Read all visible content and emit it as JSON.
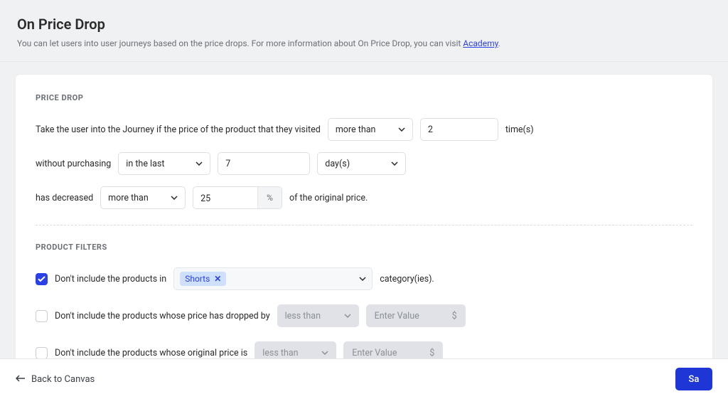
{
  "header": {
    "title": "On Price Drop",
    "desc_before": "You can let users into user journeys based on the price drops. For more information about On Price Drop, you can visit ",
    "desc_link": "Academy",
    "desc_after": "."
  },
  "price_drop": {
    "section_label": "PRICE DROP",
    "line1_prefix": "Take the user into the Journey if the price of the product that they visited",
    "compare1_label": "more than",
    "times_value": "2",
    "times_suffix": "time(s)",
    "line2_prefix": "without purchasing",
    "window_label": "in the last",
    "window_value": "7",
    "window_unit": "day(s)",
    "line3_prefix": "has decreased",
    "compare3_label": "more than",
    "percent_value": "25",
    "percent_symbol": "%",
    "line3_suffix": "of the original price."
  },
  "product_filters": {
    "section_label": "PRODUCT FILTERS",
    "f1": {
      "checked": true,
      "label": "Don't include the products in",
      "tag": "Shorts",
      "suffix": "category(ies)."
    },
    "f2": {
      "checked": false,
      "label": "Don't include the products whose price has dropped by",
      "compare": "less than",
      "placeholder": "Enter Value",
      "unit": "$"
    },
    "f3": {
      "checked": false,
      "label": "Don't include the products whose original price is",
      "compare": "less than",
      "placeholder": "Enter Value",
      "unit": "$"
    }
  },
  "footer": {
    "back": "Back to Canvas",
    "save": "Sa"
  }
}
